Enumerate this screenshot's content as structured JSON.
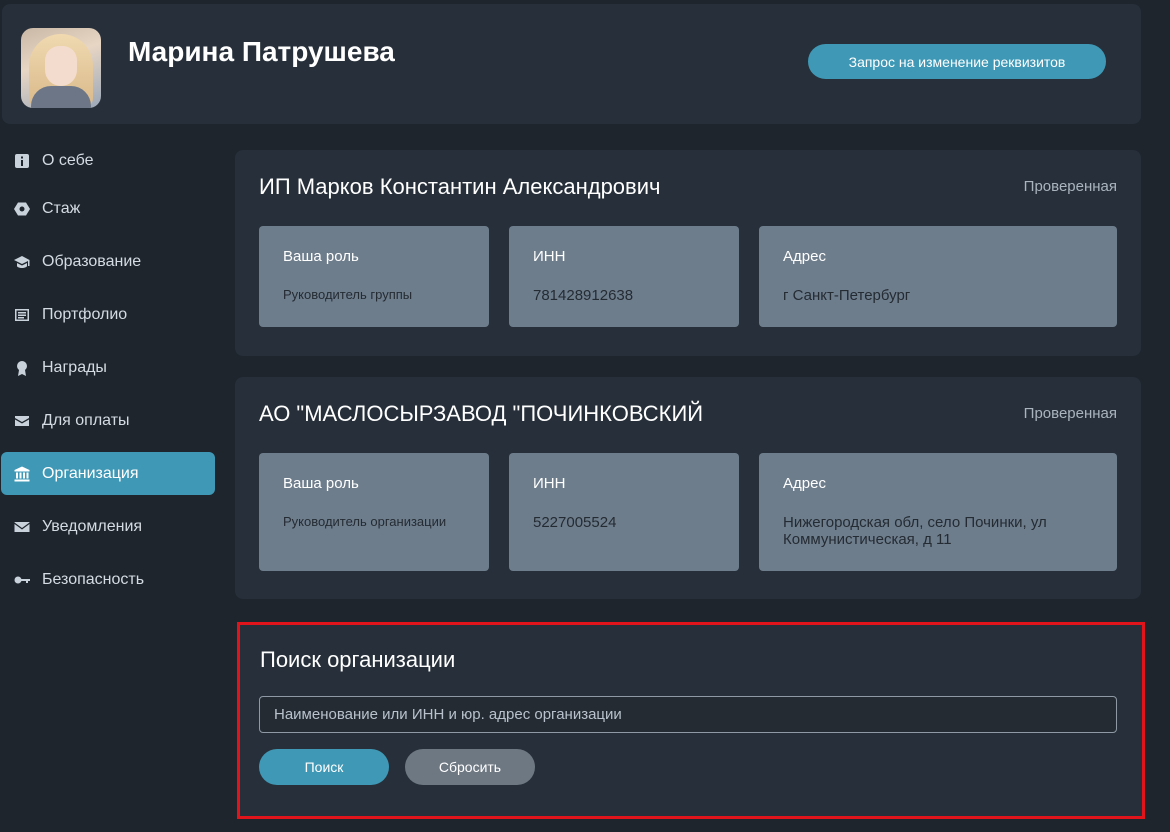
{
  "profile": {
    "name": "Марина Патрушева",
    "request_button": "Запрос на изменение реквизитов"
  },
  "sidebar": {
    "items": [
      {
        "label": "О себе",
        "icon": "info-icon",
        "active": false
      },
      {
        "label": "Стаж",
        "icon": "hexagon-icon",
        "active": false
      },
      {
        "label": "Образование",
        "icon": "graduation-cap-icon",
        "active": false
      },
      {
        "label": "Портфолио",
        "icon": "list-icon",
        "active": false
      },
      {
        "label": "Награды",
        "icon": "award-icon",
        "active": false
      },
      {
        "label": "Для оплаты",
        "icon": "wallet-icon",
        "active": false
      },
      {
        "label": "Организация",
        "icon": "bank-icon",
        "active": true
      },
      {
        "label": "Уведомления",
        "icon": "envelope-icon",
        "active": false
      },
      {
        "label": "Безопасность",
        "icon": "key-icon",
        "active": false
      }
    ]
  },
  "organizations": [
    {
      "name": "ИП Марков Константин Александрович",
      "status": "Проверенная",
      "role_label": "Ваша роль",
      "role": "Руководитель группы",
      "inn_label": "ИНН",
      "inn": "781428912638",
      "address_label": "Адрес",
      "address": "г Санкт-Петербург"
    },
    {
      "name": "АО \"МАСЛОСЫРЗАВОД \"ПОЧИНКОВСКИЙ",
      "status": "Проверенная",
      "role_label": "Ваша роль",
      "role": "Руководитель организации",
      "inn_label": "ИНН",
      "inn": "5227005524",
      "address_label": "Адрес",
      "address": "Нижегородская обл, село Починки, ул Коммунистическая, д 11"
    }
  ],
  "search": {
    "title": "Поиск организации",
    "placeholder": "Наименование или ИНН и юр. адрес организации",
    "value": "",
    "search_button": "Поиск",
    "reset_button": "Сбросить"
  },
  "colors": {
    "accent": "#3f98b5",
    "background": "#1e252d",
    "card": "#27303a",
    "info_box": "#6e7d8c",
    "highlight_border": "#e0141a"
  }
}
